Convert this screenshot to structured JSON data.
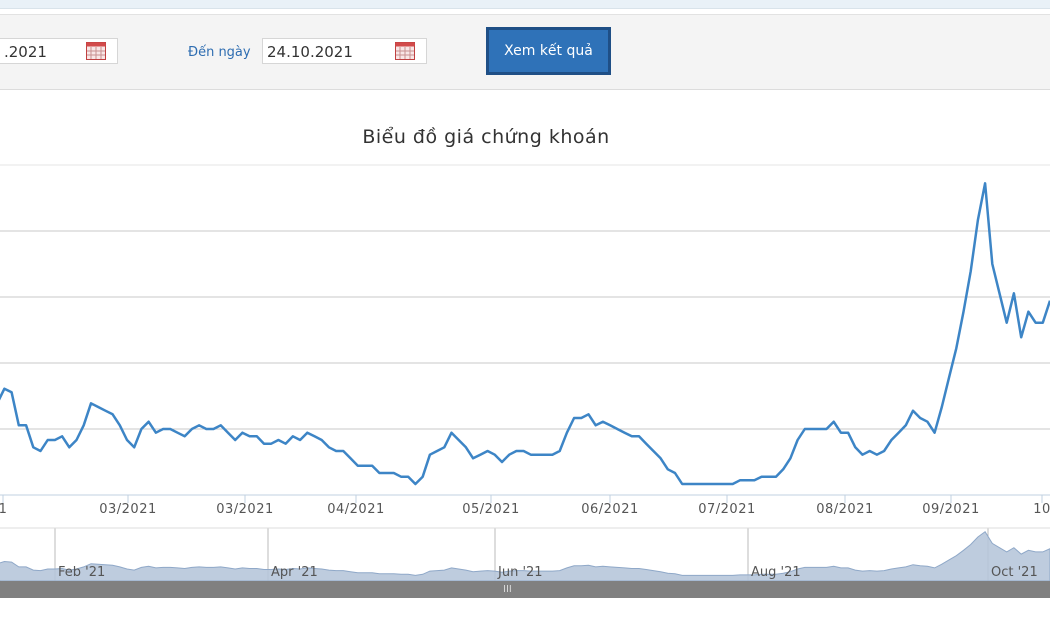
{
  "filters": {
    "from_date_value": ".2021",
    "to_label": "Đến ngày",
    "to_date_value": "24.10.2021",
    "submit_label": "Xem kết quả"
  },
  "icons": {
    "calendar": "calendar-icon",
    "grip": "grip-icon"
  },
  "colors": {
    "line": "#3d85c6",
    "navigator_fill": "#b7c6da",
    "button": "#2f72b8"
  },
  "chart_data": {
    "type": "line",
    "title": "Biểu đồ giá chứng khoán",
    "x_ticks": [
      "1",
      "03/2021",
      "03/2021",
      "04/2021",
      "05/2021",
      "06/2021",
      "07/2021",
      "08/2021",
      "09/2021",
      "10"
    ],
    "navigator_ticks": [
      "Feb '21",
      "Apr '21",
      "Jun '21",
      "Aug '21",
      "Oct '21"
    ],
    "y_gridlines": 5,
    "grid": true,
    "series": [
      {
        "values": [
          62,
          60,
          64,
          63,
          54,
          54,
          48,
          47,
          50,
          50,
          51,
          48,
          50,
          54,
          60,
          59,
          58,
          57,
          54,
          50,
          48,
          53,
          55,
          52,
          53,
          53,
          52,
          51,
          53,
          54,
          53,
          53,
          54,
          52,
          50,
          52,
          51,
          51,
          49,
          49,
          50,
          49,
          51,
          50,
          52,
          51,
          50,
          48,
          47,
          47,
          45,
          43,
          43,
          43,
          41,
          41,
          41,
          40,
          40,
          38,
          40,
          46,
          47,
          48,
          52,
          50,
          48,
          45,
          46,
          47,
          46,
          44,
          46,
          47,
          47,
          46,
          46,
          46,
          46,
          47,
          52,
          56,
          56,
          57,
          54,
          55,
          54,
          53,
          52,
          51,
          51,
          49,
          47,
          45,
          42,
          41,
          38,
          38,
          38,
          38,
          38,
          38,
          38,
          38,
          39,
          39,
          39,
          40,
          40,
          40,
          42,
          45,
          50,
          53,
          53,
          53,
          53,
          55,
          52,
          52,
          48,
          46,
          47,
          46,
          47,
          50,
          52,
          54,
          58,
          56,
          55,
          52,
          59,
          67,
          75,
          85,
          96,
          110,
          120,
          98,
          90,
          82,
          90,
          78,
          85,
          82,
          82,
          88
        ]
      }
    ]
  }
}
